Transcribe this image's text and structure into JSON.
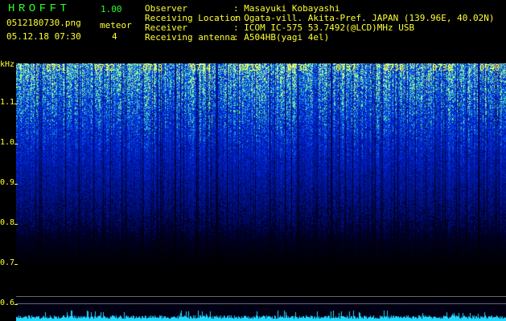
{
  "app": {
    "title": "HROFFT",
    "version": "1.00"
  },
  "file": {
    "name": "0512180730.png",
    "datetime": "05.12.18 07:30"
  },
  "meteor": {
    "label": "meteor",
    "count": "4"
  },
  "info": [
    {
      "label": "Observer",
      "value": ": Masayuki Kobayashi"
    },
    {
      "label": "Receiving Location",
      "value": ": Ogata-vill. Akita-Pref. JAPAN (139.96E, 40.02N)"
    },
    {
      "label": "Receiver",
      "value": ": ICOM IC-575 53.7492(@LCD)MHz USB"
    },
    {
      "label": "Receiving antenna",
      "value": ": A504HB(yagi 4el)"
    }
  ],
  "y_axis": {
    "unit": "kHz",
    "ticks": [
      "1.1",
      "1.0",
      "0.9",
      "0.8",
      "0.7",
      "0.6"
    ]
  },
  "x_axis": {
    "ticks": [
      "0731",
      "0732",
      "0733",
      "0734",
      "0735",
      "0736",
      "0737",
      "0738",
      "0739",
      "0740"
    ]
  },
  "colors": {
    "text": "#ffff33",
    "title": "#2aff2a",
    "background": "#000000",
    "signal_low": "#1d3cd6",
    "signal_high": "#00ffff"
  }
}
